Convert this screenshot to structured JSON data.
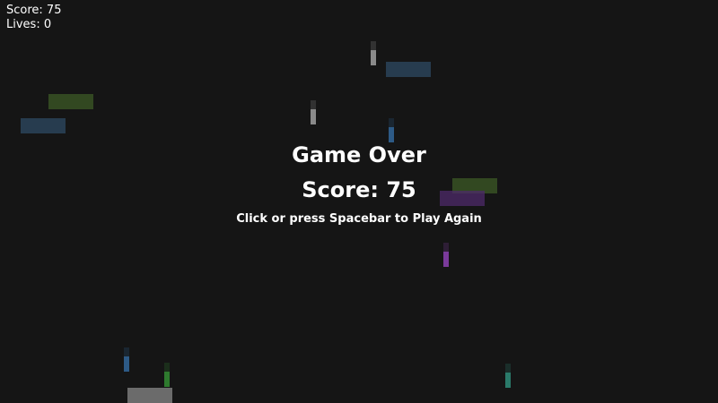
{
  "hud": {
    "score_text": "Score: 75",
    "lives_text": "Lives: 0"
  },
  "game_over": {
    "title": "Game Over",
    "score_text": "Score: 75",
    "prompt": "Click or press Spacebar to Play Again"
  },
  "colors": {
    "background": "#151515",
    "text": "#ffffff",
    "player": "#6b6b6b",
    "block_blue": "#2d4a63",
    "block_green": "#3c5a26",
    "block_purple": "#4d2a6a",
    "bullet_gray": "#8a8a8a",
    "bullet_blue": "#2d5a86",
    "bullet_green": "#2e7a2e",
    "bullet_purple": "#7a3a9a",
    "bullet_teal": "#2a7a6a"
  }
}
